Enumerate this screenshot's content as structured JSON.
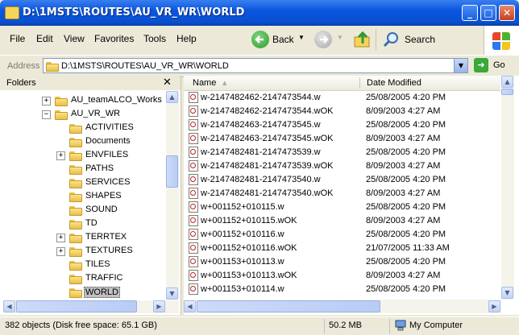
{
  "window": {
    "title": "D:\\1MSTS\\ROUTES\\AU_VR_WR\\WORLD",
    "minimize": "_",
    "maximize": "□",
    "close": "✕"
  },
  "menubar": {
    "items": [
      {
        "label": "File"
      },
      {
        "label": "Edit"
      },
      {
        "label": "View"
      },
      {
        "label": "Favorites"
      },
      {
        "label": "Tools"
      },
      {
        "label": "Help"
      }
    ]
  },
  "toolbar": {
    "back_label": "Back",
    "search_label": "Search",
    "back_icon": "back-arrow-icon",
    "forward_icon": "forward-arrow-icon",
    "up_icon": "up-folder-icon",
    "search_icon": "search-icon"
  },
  "address": {
    "label": "Address",
    "value": "D:\\1MSTS\\ROUTES\\AU_VR_WR\\WORLD",
    "go_label": "Go"
  },
  "folders": {
    "title": "Folders",
    "close": "✕",
    "items": [
      {
        "label": "AU_teamALCO_Works",
        "expander": "+"
      },
      {
        "label": "AU_VR_WR",
        "expander": "−"
      },
      {
        "label": "ACTIVITIES",
        "expander": ""
      },
      {
        "label": "Documents",
        "expander": ""
      },
      {
        "label": "ENVFILES",
        "expander": "+"
      },
      {
        "label": "PATHS",
        "expander": ""
      },
      {
        "label": "SERVICES",
        "expander": ""
      },
      {
        "label": "SHAPES",
        "expander": ""
      },
      {
        "label": "SOUND",
        "expander": ""
      },
      {
        "label": "TD",
        "expander": ""
      },
      {
        "label": "TERRTEX",
        "expander": "+"
      },
      {
        "label": "TEXTURES",
        "expander": "+"
      },
      {
        "label": "TILES",
        "expander": ""
      },
      {
        "label": "TRAFFIC",
        "expander": ""
      },
      {
        "label": "WORLD",
        "expander": "",
        "selected": true
      }
    ]
  },
  "filelist": {
    "columns": {
      "name": "Name",
      "date": "Date Modified"
    },
    "rows": [
      {
        "name": "w-2147482462-2147473544.w",
        "date": "25/08/2005 4:20 PM"
      },
      {
        "name": "w-2147482462-2147473544.wOK",
        "date": "8/09/2003 4:27 AM"
      },
      {
        "name": "w-2147482463-2147473545.w",
        "date": "25/08/2005 4:20 PM"
      },
      {
        "name": "w-2147482463-2147473545.wOK",
        "date": "8/09/2003 4:27 AM"
      },
      {
        "name": "w-2147482481-2147473539.w",
        "date": "25/08/2005 4:20 PM"
      },
      {
        "name": "w-2147482481-2147473539.wOK",
        "date": "8/09/2003 4:27 AM"
      },
      {
        "name": "w-2147482481-2147473540.w",
        "date": "25/08/2005 4:20 PM"
      },
      {
        "name": "w-2147482481-2147473540.wOK",
        "date": "8/09/2003 4:27 AM"
      },
      {
        "name": "w+001152+010115.w",
        "date": "25/08/2005 4:20 PM"
      },
      {
        "name": "w+001152+010115.wOK",
        "date": "8/09/2003 4:27 AM"
      },
      {
        "name": "w+001152+010116.w",
        "date": "25/08/2005 4:20 PM"
      },
      {
        "name": "w+001152+010116.wOK",
        "date": "21/07/2005 11:33 AM"
      },
      {
        "name": "w+001153+010113.w",
        "date": "25/08/2005 4:20 PM"
      },
      {
        "name": "w+001153+010113.wOK",
        "date": "8/09/2003 4:27 AM"
      },
      {
        "name": "w+001153+010114.w",
        "date": "25/08/2005 4:20 PM"
      }
    ]
  },
  "statusbar": {
    "objects": "382 objects (Disk free space: 65.1 GB)",
    "size": "50.2 MB",
    "location": "My Computer"
  },
  "colors": {
    "titlebar": "#0a56e0",
    "chrome": "#ece9d8",
    "go_green": "#3aa83a"
  }
}
